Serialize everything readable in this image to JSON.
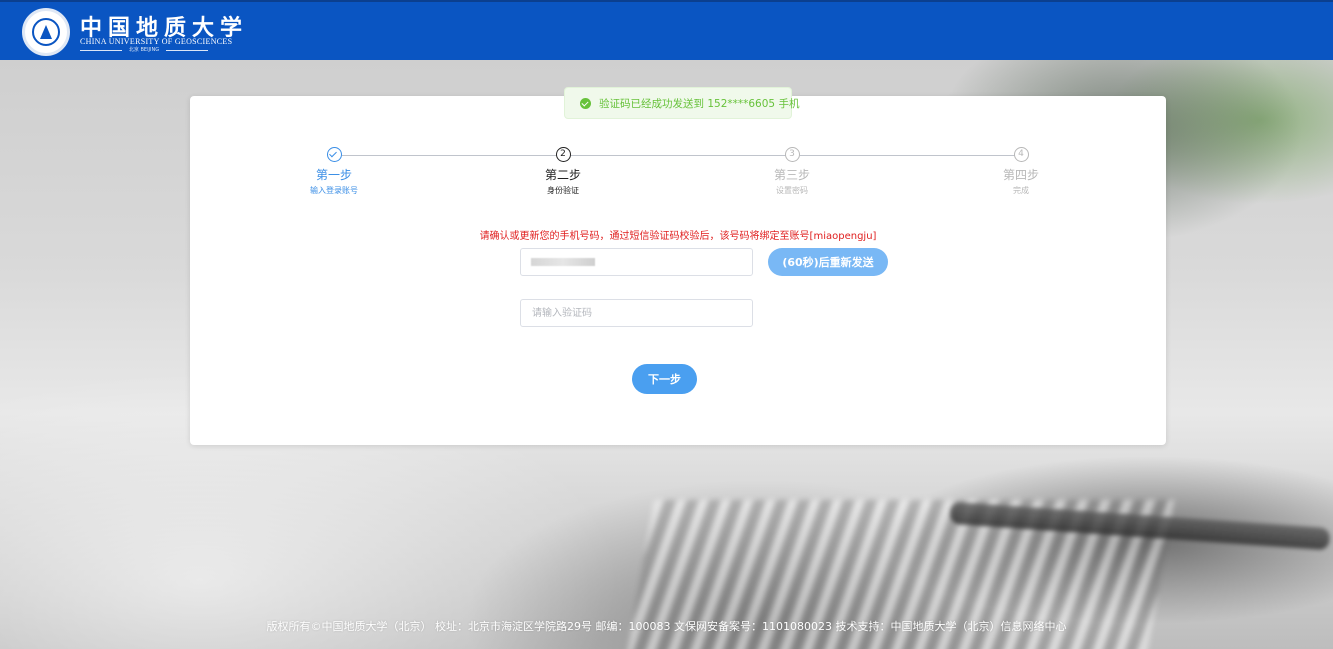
{
  "header": {
    "logo_cn": "中国地质大学",
    "logo_en": "CHINA UNIVERSITY OF GEOSCIENCES",
    "logo_sub": "北京 BEIJING"
  },
  "toast": {
    "message": "验证码已经成功发送到 152****6605 手机"
  },
  "steps": [
    {
      "number": "1",
      "title": "第一步",
      "desc": "输入登录账号",
      "state": "done"
    },
    {
      "number": "2",
      "title": "第二步",
      "desc": "身份验证",
      "state": "active"
    },
    {
      "number": "3",
      "title": "第三步",
      "desc": "设置密码",
      "state": "wait"
    },
    {
      "number": "4",
      "title": "第四步",
      "desc": "完成",
      "state": "wait"
    }
  ],
  "form": {
    "notice": "请确认或更新您的手机号码，通过短信验证码校验后，该号码将绑定至账号[miaopengju]",
    "phone_value": "",
    "resend_label": "(60秒)后重新发送",
    "code_placeholder": "请输入验证码",
    "code_value": "",
    "next_label": "下一步"
  },
  "footer": {
    "text": "版权所有©中国地质大学（北京） 校址：北京市海淀区学院路29号 邮编：100083 文保网安备案号：1101080023 技术支持：中国地质大学（北京）信息网络中心"
  },
  "colors": {
    "header_bg": "#0a55c2",
    "primary": "#3a8ee6",
    "button": "#4a9ff0",
    "button_disabled": "#79b8f5",
    "success": "#67c23a",
    "warning_text": "#e02020"
  }
}
